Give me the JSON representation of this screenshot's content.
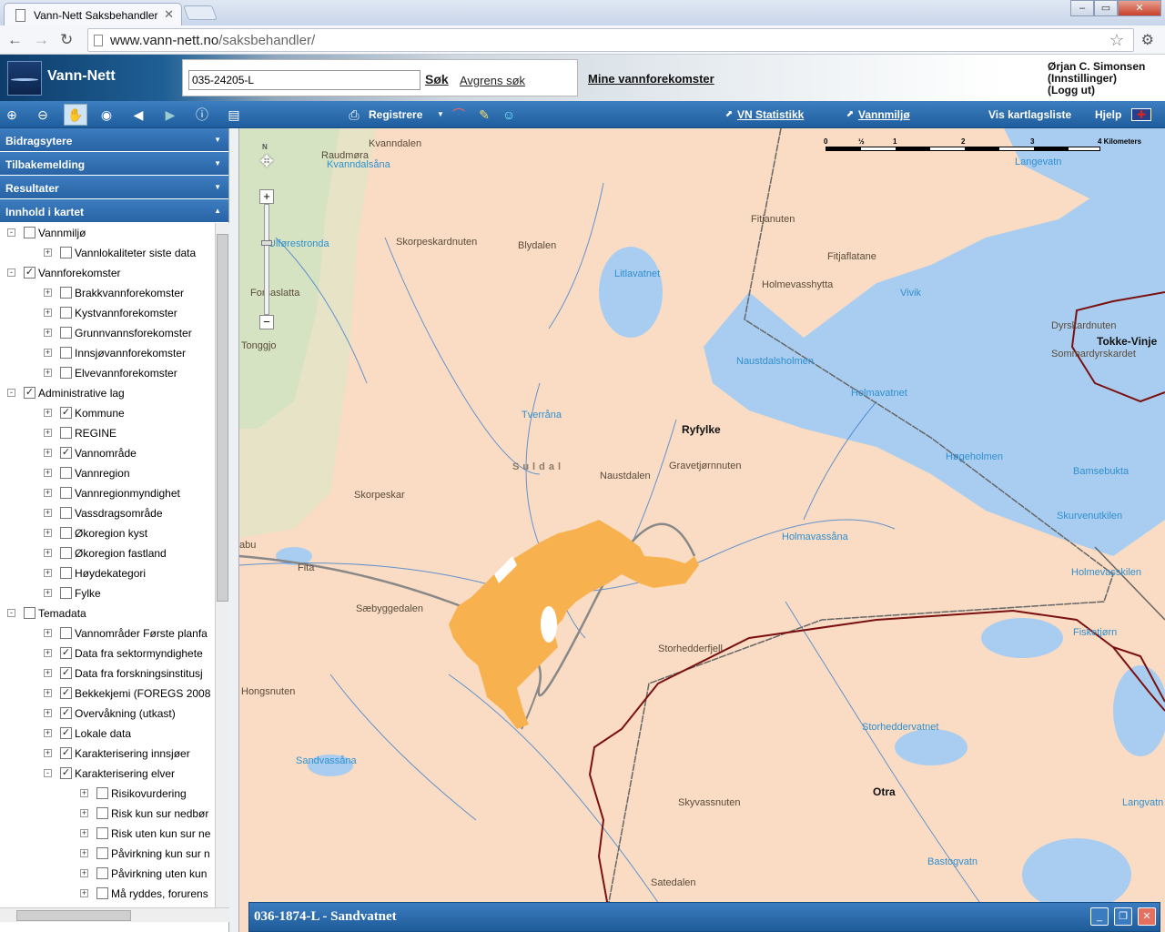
{
  "browser": {
    "tab_title": "Vann-Nett Saksbehandler",
    "url_host": "www.vann-nett.no",
    "url_path": "/saksbehandler/"
  },
  "header": {
    "app_name": "Vann-Nett",
    "search_value": "035-24205-L",
    "search_button": "Søk",
    "refine_link": "Avgrens søk",
    "my_link": "Mine vannforekomster",
    "user_name": "Ørjan C. Simonsen",
    "user_settings": "(Innstillinger)",
    "user_logout": "(Logg ut)"
  },
  "toolbar": {
    "register_label": "Registrere",
    "stats_link": "VN Statistikk",
    "env_link": "Vannmiljø",
    "layers_link": "Vis kartlagsliste",
    "help_link": "Hjelp"
  },
  "sidebar": {
    "panels": [
      "Bidragsytere",
      "Tilbakemelding",
      "Resultater",
      "Innhold i kartet"
    ],
    "tree": [
      {
        "label": "Vannmiljø",
        "level": 0,
        "checked": false,
        "expander": "-"
      },
      {
        "label": "Vannlokaliteter siste data",
        "level": 1,
        "checked": false,
        "expander": "+"
      },
      {
        "label": "Vannforekomster",
        "level": 0,
        "checked": true,
        "expander": "-"
      },
      {
        "label": "Brakkvannforekomster",
        "level": 1,
        "checked": false,
        "expander": "+"
      },
      {
        "label": "Kystvannforekomster",
        "level": 1,
        "checked": false,
        "expander": "+"
      },
      {
        "label": "Grunnvannsforekomster",
        "level": 1,
        "checked": false,
        "expander": "+"
      },
      {
        "label": "Innsjøvannforekomster",
        "level": 1,
        "checked": false,
        "expander": "+"
      },
      {
        "label": "Elvevannforekomster",
        "level": 1,
        "checked": false,
        "expander": "+"
      },
      {
        "label": "Administrative lag",
        "level": 0,
        "checked": true,
        "expander": "-"
      },
      {
        "label": "Kommune",
        "level": 1,
        "checked": true,
        "expander": "+"
      },
      {
        "label": "REGINE",
        "level": 1,
        "checked": false,
        "expander": "+"
      },
      {
        "label": "Vannområde",
        "level": 1,
        "checked": true,
        "expander": "+"
      },
      {
        "label": "Vannregion",
        "level": 1,
        "checked": false,
        "expander": "+"
      },
      {
        "label": "Vannregionmyndighet",
        "level": 1,
        "checked": false,
        "expander": "+"
      },
      {
        "label": "Vassdragsområde",
        "level": 1,
        "checked": false,
        "expander": "+"
      },
      {
        "label": "Økoregion kyst",
        "level": 1,
        "checked": false,
        "expander": "+"
      },
      {
        "label": "Økoregion fastland",
        "level": 1,
        "checked": false,
        "expander": "+"
      },
      {
        "label": "Høydekategori",
        "level": 1,
        "checked": false,
        "expander": "+"
      },
      {
        "label": "Fylke",
        "level": 1,
        "checked": false,
        "expander": "+"
      },
      {
        "label": "Temadata",
        "level": 0,
        "checked": false,
        "expander": "-"
      },
      {
        "label": "Vannområder Første planfa",
        "level": 1,
        "checked": false,
        "expander": "+"
      },
      {
        "label": "Data fra sektormyndighete",
        "level": 1,
        "checked": true,
        "expander": "+"
      },
      {
        "label": "Data fra forskningsinstitusj",
        "level": 1,
        "checked": true,
        "expander": "+"
      },
      {
        "label": "Bekkekjemi (FOREGS 2008",
        "level": 1,
        "checked": true,
        "expander": "+"
      },
      {
        "label": "Overvåkning (utkast)",
        "level": 1,
        "checked": true,
        "expander": "+"
      },
      {
        "label": "Lokale data",
        "level": 1,
        "checked": true,
        "expander": "+"
      },
      {
        "label": "Karakterisering innsjøer",
        "level": 1,
        "checked": true,
        "expander": "+"
      },
      {
        "label": "Karakterisering elver",
        "level": 1,
        "checked": true,
        "expander": "-"
      },
      {
        "label": "Risikovurdering",
        "level": 2,
        "checked": false,
        "expander": "+"
      },
      {
        "label": "Risk kun sur nedbør",
        "level": 2,
        "checked": false,
        "expander": "+"
      },
      {
        "label": "Risk uten kun sur ne",
        "level": 2,
        "checked": false,
        "expander": "+"
      },
      {
        "label": "Påvirkning kun sur n",
        "level": 2,
        "checked": false,
        "expander": "+"
      },
      {
        "label": "Påvirkning uten kun",
        "level": 2,
        "checked": false,
        "expander": "+"
      },
      {
        "label": "Må ryddes, forurens",
        "level": 2,
        "checked": false,
        "expander": "+"
      }
    ]
  },
  "map": {
    "places": [
      {
        "name": "Kvanndalen",
        "kind": "place"
      },
      {
        "name": "Raudmøra",
        "kind": "place"
      },
      {
        "name": "Kvanndalsåna",
        "kind": "water"
      },
      {
        "name": "Skorpeskardnuten",
        "kind": "place"
      },
      {
        "name": "Blydalen",
        "kind": "place"
      },
      {
        "name": "Fitjanuten",
        "kind": "place"
      },
      {
        "name": "Langevatn",
        "kind": "water"
      },
      {
        "name": "Ulførestronda",
        "kind": "water"
      },
      {
        "name": "Litlavatnet",
        "kind": "water"
      },
      {
        "name": "Fitjaflatane",
        "kind": "place"
      },
      {
        "name": "Forsaslatta",
        "kind": "place"
      },
      {
        "name": "Holmevasshytta",
        "kind": "place"
      },
      {
        "name": "Vivik",
        "kind": "water"
      },
      {
        "name": "Dyrskardnuten",
        "kind": "place"
      },
      {
        "name": "Tonggjo",
        "kind": "place"
      },
      {
        "name": "Tokke-Vinje",
        "kind": "admin"
      },
      {
        "name": "Sommardyrskardet",
        "kind": "place"
      },
      {
        "name": "Naustdalsholmen",
        "kind": "water"
      },
      {
        "name": "Holmavatnet",
        "kind": "water"
      },
      {
        "name": "Tverråna",
        "kind": "water"
      },
      {
        "name": "Ryfylke",
        "kind": "admin"
      },
      {
        "name": "Gravetjørnnuten",
        "kind": "place"
      },
      {
        "name": "Høgeholmen",
        "kind": "water"
      },
      {
        "name": "Bamsebukta",
        "kind": "water"
      },
      {
        "name": "Suldal",
        "kind": "place"
      },
      {
        "name": "Naustdalen",
        "kind": "place"
      },
      {
        "name": "Skorpeskar",
        "kind": "place"
      },
      {
        "name": "Skurvenutkilen",
        "kind": "water"
      },
      {
        "name": "Holmavassåna",
        "kind": "water"
      },
      {
        "name": "abu",
        "kind": "place"
      },
      {
        "name": "Fita",
        "kind": "place"
      },
      {
        "name": "Holmevasskilen",
        "kind": "water"
      },
      {
        "name": "Sæbyggedalen",
        "kind": "place"
      },
      {
        "name": "Fisketjørn",
        "kind": "water"
      },
      {
        "name": "Storhedderfjell",
        "kind": "place"
      },
      {
        "name": "Hongsnuten",
        "kind": "place"
      },
      {
        "name": "Storheddervatnet",
        "kind": "water"
      },
      {
        "name": "Sandvassåna",
        "kind": "water"
      },
      {
        "name": "Otra",
        "kind": "admin"
      },
      {
        "name": "Skyvassnuten",
        "kind": "place"
      },
      {
        "name": "Langvatn",
        "kind": "water"
      },
      {
        "name": "Bastogvatn",
        "kind": "water"
      },
      {
        "name": "Satedalen",
        "kind": "place"
      }
    ],
    "scale_labels": [
      "0",
      "½",
      "1",
      "2",
      "3",
      "4 Kilometers"
    ],
    "compass_label": "N",
    "selected_color": "#f7b24f",
    "water_color": "#a9cdf0"
  },
  "popup": {
    "title": "036-1874-L - Sandvatnet"
  }
}
